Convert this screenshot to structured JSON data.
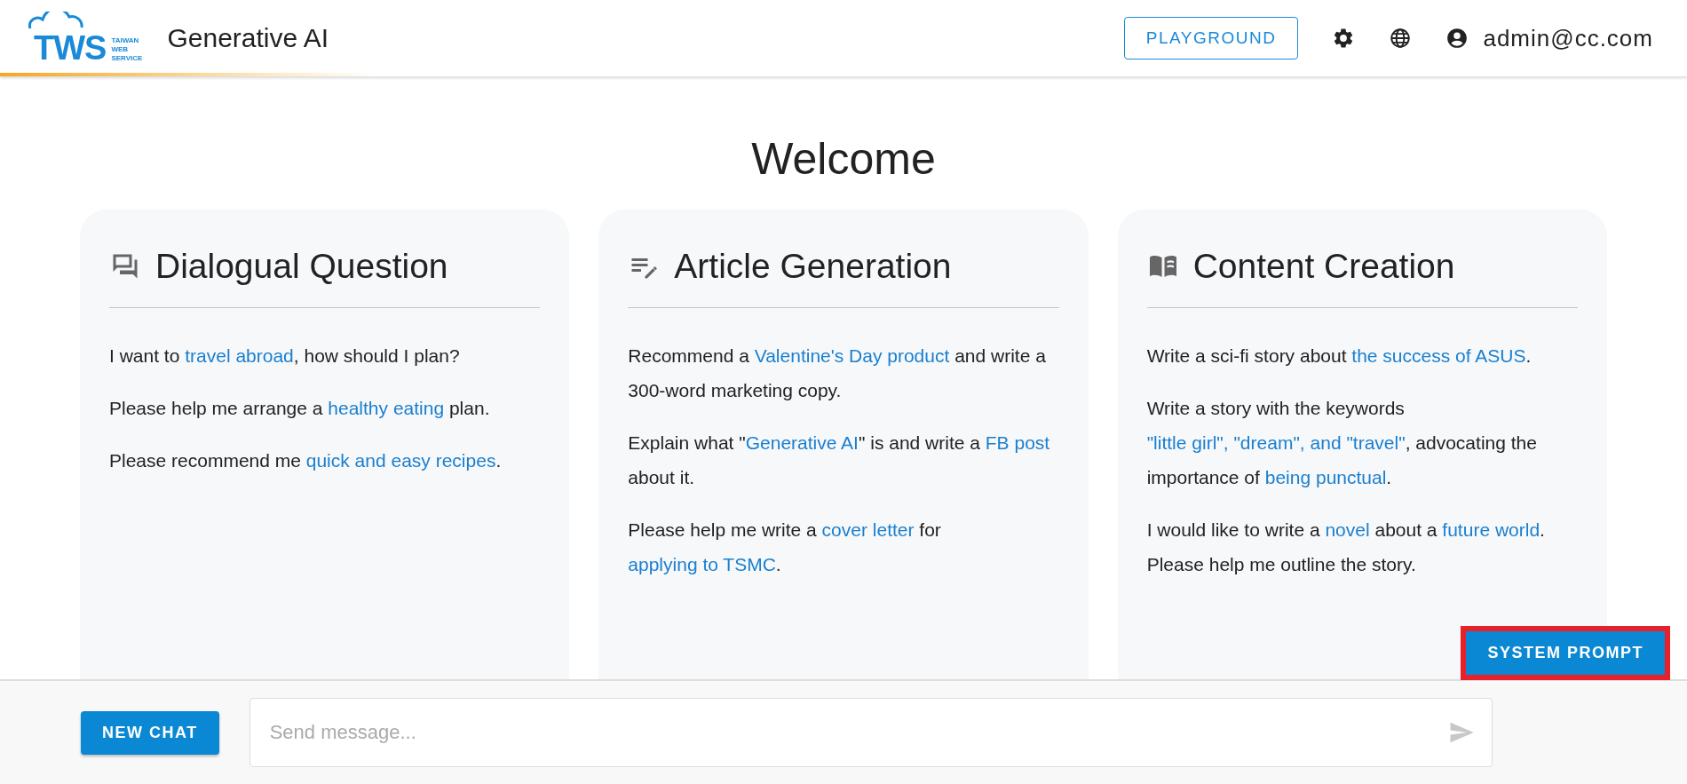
{
  "header": {
    "logo": {
      "mark": "TWS",
      "lines": [
        "TAIWAN",
        "WEB",
        "SERVICE"
      ]
    },
    "title": "Generative AI",
    "playground_button": "PLAYGROUND",
    "user": "admin@cc.com"
  },
  "welcome": "Welcome",
  "cards": [
    {
      "kind": "dialogue",
      "title": "Dialogual Question",
      "prompts": [
        [
          {
            "text": "I want to ",
            "link": false
          },
          {
            "text": "travel abroad",
            "link": true
          },
          {
            "text": ", how should I plan?",
            "link": false
          }
        ],
        [
          {
            "text": "Please help me arrange a ",
            "link": false
          },
          {
            "text": "healthy eating",
            "link": true
          },
          {
            "text": " plan.",
            "link": false
          }
        ],
        [
          {
            "text": "Please recommend me ",
            "link": false
          },
          {
            "text": "quick and easy recipes",
            "link": true
          },
          {
            "text": ".",
            "link": false
          }
        ]
      ]
    },
    {
      "kind": "article",
      "title": "Article Generation",
      "prompts": [
        [
          {
            "text": "Recommend a ",
            "link": false
          },
          {
            "text": "Valentine's Day product",
            "link": true
          },
          {
            "text": " and write a 300-word marketing copy.",
            "link": false
          }
        ],
        [
          {
            "text": "Explain what \"",
            "link": false
          },
          {
            "text": "Generative AI",
            "link": true
          },
          {
            "text": "\" is and write a ",
            "link": false
          },
          {
            "text": "FB post",
            "link": true
          },
          {
            "text": " about it.",
            "link": false
          }
        ],
        [
          {
            "text": "Please help me write a ",
            "link": false
          },
          {
            "text": "cover letter",
            "link": true
          },
          {
            "text": " for ",
            "link": false
          },
          {
            "text": "applying to TSMC",
            "link": true
          },
          {
            "text": ".",
            "link": false
          }
        ]
      ]
    },
    {
      "kind": "content",
      "title": "Content Creation",
      "prompts": [
        [
          {
            "text": "Write a sci-fi story about ",
            "link": false
          },
          {
            "text": "the success of ASUS",
            "link": true
          },
          {
            "text": ".",
            "link": false
          }
        ],
        [
          {
            "text": "Write a story with the keywords ",
            "link": false
          },
          {
            "text": "\"little girl\", \"dream\", and \"travel\"",
            "link": true
          },
          {
            "text": ", advocating the importance of ",
            "link": false
          },
          {
            "text": "being punctual",
            "link": true
          },
          {
            "text": ".",
            "link": false
          }
        ],
        [
          {
            "text": "I would like to write a ",
            "link": false
          },
          {
            "text": "novel",
            "link": true
          },
          {
            "text": " about a ",
            "link": false
          },
          {
            "text": "future world",
            "link": true
          },
          {
            "text": ". Please help me outline the story.",
            "link": false
          }
        ]
      ]
    }
  ],
  "system_prompt_button": {
    "label": "SYSTEM PROMPT",
    "highlighted": true
  },
  "footer": {
    "new_chat_button": "NEW CHAT",
    "message_field": {
      "placeholder": "Send message..."
    }
  }
}
